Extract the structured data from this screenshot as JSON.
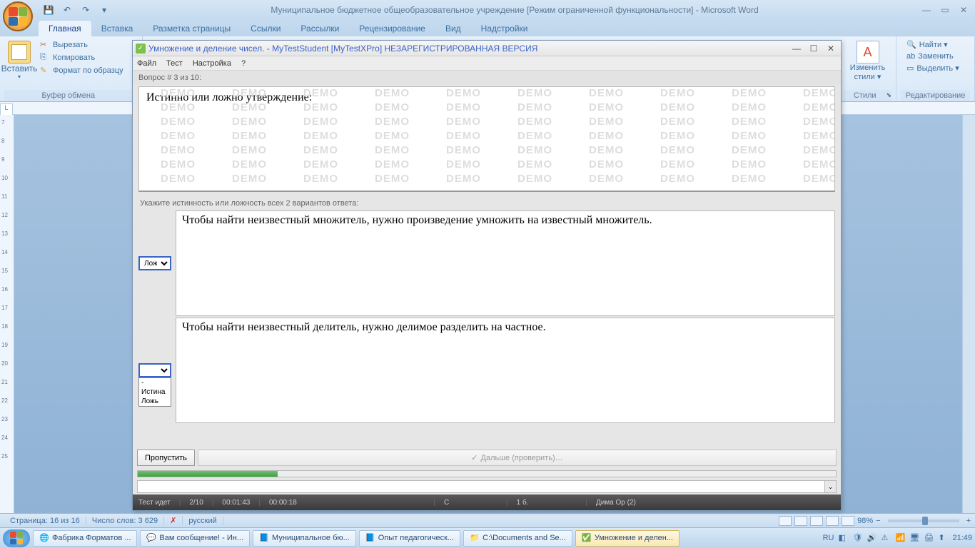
{
  "word": {
    "title": "Муниципальное бюджетное общеобразовательное учреждение [Режим ограниченной функциональности] - Microsoft Word",
    "tabs": [
      "Главная",
      "Вставка",
      "Разметка страницы",
      "Ссылки",
      "Рассылки",
      "Рецензирование",
      "Вид",
      "Надстройки"
    ],
    "clipboard": {
      "paste": "Вставить",
      "cut": "Вырезать",
      "copy": "Копировать",
      "format": "Формат по образцу",
      "group": "Буфер обмена"
    },
    "styles": {
      "change": "Изменить стили ▾",
      "group": "Стили"
    },
    "editing": {
      "find": "Найти ▾",
      "replace": "Заменить",
      "select": "Выделить ▾",
      "group": "Редактирование"
    },
    "status": {
      "page": "Страница: 16 из 16",
      "words": "Число слов: 3 629",
      "lang": "русский",
      "zoom": "98%"
    }
  },
  "mytest": {
    "title": "Умножение и деление чисел. - MyTestStudent [MyTestXPro] НЕЗАРЕГИСТРИРОВАННАЯ ВЕРСИЯ",
    "menu": [
      "Файл",
      "Тест",
      "Настройка",
      "?"
    ],
    "q_header": "Вопрос # 3 из 10:",
    "question": "Истинно или ложно утверждение:",
    "demo": "DEMO",
    "instruction": "Укажите истинность или ложность всех 2 вариантов ответа:",
    "answers": [
      {
        "sel": "Ложь",
        "text": "Чтобы найти неизвестный множитель, нужно произведение умножить на известный множитель."
      },
      {
        "sel": "",
        "text": "Чтобы найти неизвестный делитель, нужно делимое разделить на частное."
      }
    ],
    "dropdown_options": [
      "-",
      "Истина",
      "Ложь"
    ],
    "skip": "Пропустить",
    "next": "Дальше (проверить)…",
    "status": {
      "running": "Тест идет",
      "progress": "2/10",
      "t1": "00:01:43",
      "t2": "00:00:18",
      "c": "С",
      "b": "1 б.",
      "user": "Дима Ор (2)"
    }
  },
  "taskbar": {
    "items": [
      {
        "label": "Фабрика Форматов ...",
        "active": false
      },
      {
        "label": "Вам сообщение! - Ин...",
        "active": false
      },
      {
        "label": "Муниципальное бю...",
        "active": false
      },
      {
        "label": "Опыт педагогическ...",
        "active": false
      },
      {
        "label": "C:\\Documents and Se...",
        "active": false
      },
      {
        "label": "Умножение и делен...",
        "active": true
      }
    ],
    "lang": "RU",
    "time": "21:49"
  }
}
